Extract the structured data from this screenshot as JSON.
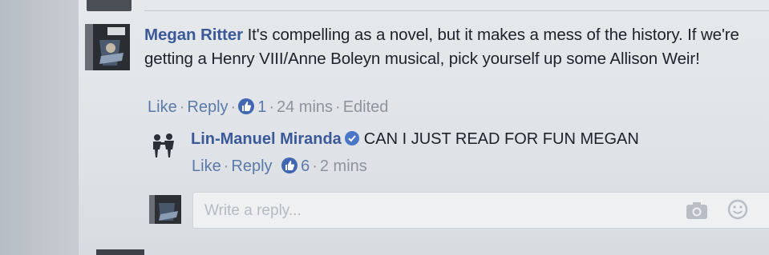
{
  "comment": {
    "author": "Megan Ritter",
    "text": "It's compelling as a novel, but it makes a mess of the history. If we're getting a Henry VIII/Anne Boleyn musical, pick yourself up some Allison Weir!",
    "actions": {
      "like_label": "Like",
      "reply_label": "Reply",
      "like_count": "1",
      "time": "24 mins",
      "edited": "Edited"
    }
  },
  "reply": {
    "author": "Lin-Manuel Miranda",
    "text": "CAN I JUST READ FOR FUN MEGAN",
    "actions": {
      "like_label": "Like",
      "reply_label": "Reply",
      "like_count": "6",
      "time": "2 mins"
    }
  },
  "reply_box": {
    "placeholder": "Write a reply..."
  },
  "colors": {
    "author_link": "#3b5998",
    "action_link": "#5b7aa8",
    "like_badge": "#4267b2",
    "meta": "#8d949e"
  },
  "icons": [
    "like-thumb-icon",
    "verified-badge-icon",
    "camera-icon",
    "emoji-icon"
  ]
}
